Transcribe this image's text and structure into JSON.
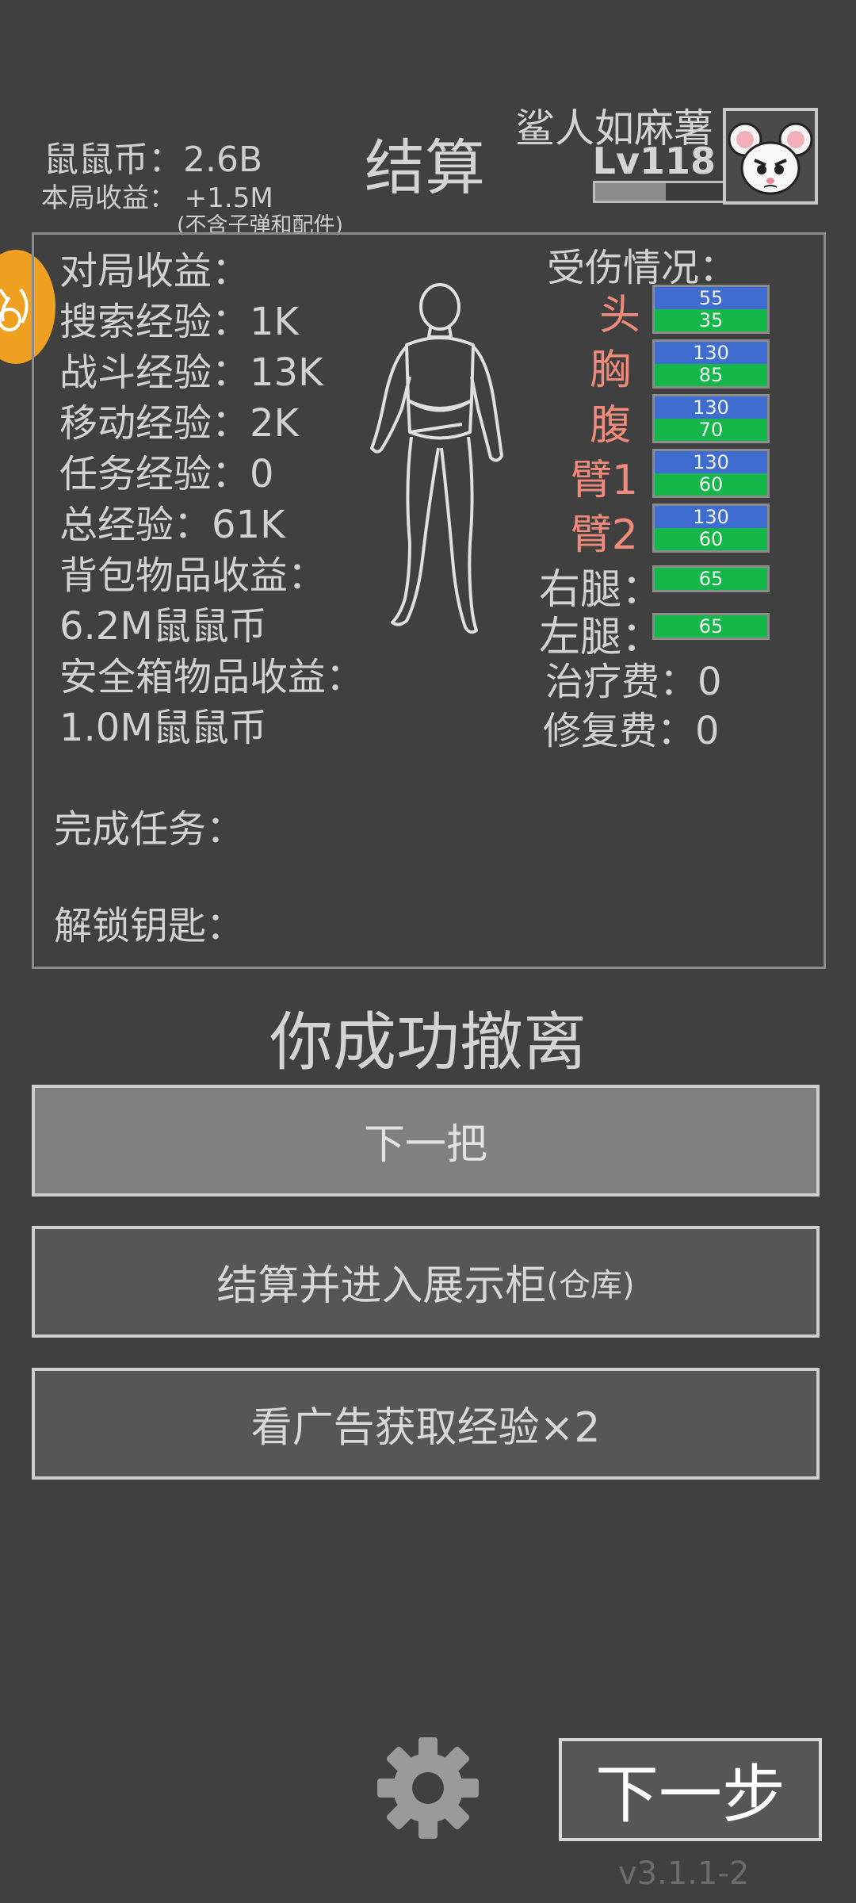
{
  "header": {
    "coin_label": "鼠鼠币：2.6B",
    "income_label": "本局收益： +1.5M",
    "income_note": "(不含子弹和配件)",
    "title": "结算",
    "player_name": "鲨人如麻薯",
    "level": "Lv118",
    "xp_progress": 0.55
  },
  "stats": {
    "match_income": "对局收益：",
    "search_exp": "搜索经验：1K",
    "combat_exp": "战斗经验：13K",
    "move_exp": "移动经验：2K",
    "task_exp": "任务经验：0",
    "total_exp": "总经验：61K",
    "bag_income_label": "背包物品收益：",
    "bag_income_value": "6.2M鼠鼠币",
    "safe_income_label": "安全箱物品收益：",
    "safe_income_value": "1.0M鼠鼠币",
    "tasks_done": "完成任务：",
    "keys_unlocked": "解锁钥匙："
  },
  "injury": {
    "title": "受伤情况：",
    "parts": [
      {
        "label": "头",
        "max": "55",
        "hp": "35"
      },
      {
        "label": "胸",
        "max": "130",
        "hp": "85"
      },
      {
        "label": "腹",
        "max": "130",
        "hp": "70"
      },
      {
        "label": "臂1",
        "max": "130",
        "hp": "60"
      },
      {
        "label": "臂2",
        "max": "130",
        "hp": "60"
      }
    ],
    "legs": [
      {
        "label": "右腿：",
        "hp": "65"
      },
      {
        "label": "左腿：",
        "hp": "65"
      }
    ],
    "heal_fee": "治疗费：0",
    "repair_fee": "修复费：0"
  },
  "result_text": "你成功撤离",
  "buttons": {
    "next_round": "下一把",
    "settle_main": "结算并进入展示柜",
    "settle_sub": "(仓库)",
    "watch_ad": "看广告获取经验×2",
    "next_step": "下一步"
  },
  "version": "v3.1.1-2",
  "colors": {
    "background": "#404040",
    "part_label": "#f08a7a",
    "bar_blue": "#3f6ccf",
    "bar_green": "#15b74a",
    "bubble": "#f0a020"
  },
  "icons": [
    "mouse-avatar-icon",
    "settings-gear-icon",
    "body-silhouette-icon",
    "side-bubble-icon"
  ]
}
